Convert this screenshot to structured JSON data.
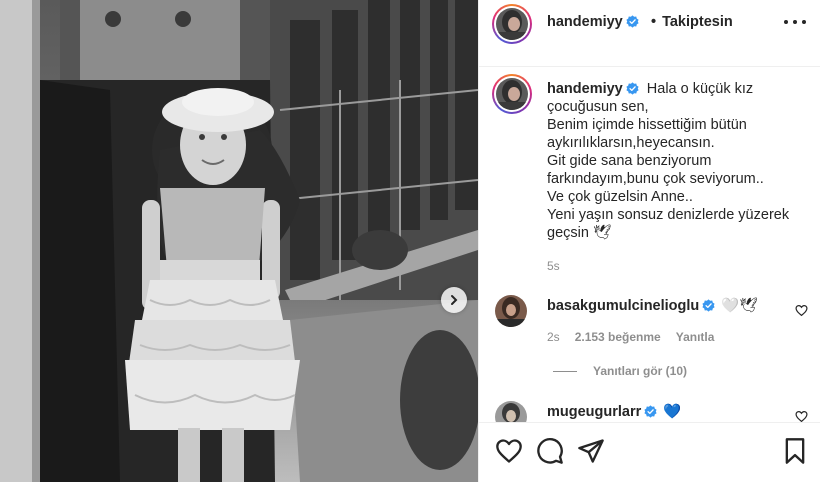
{
  "post": {
    "author": "handemiyy",
    "header_follow": "Takiptesin",
    "header_bullet": "•",
    "caption_lines": [
      "Hala o küçük kız",
      "çocuğusun sen,",
      "Benim içimde hissettiğim bütün",
      "aykırılıklarsın,heyecansın.",
      "Git gide sana benziyorum",
      "farkındayım,bunu çok seviyorum..",
      "Ve çok güzelsin Anne..",
      "Yeni yaşın sonsuz denizlerde yüzerek",
      "geçsin 🕊"
    ],
    "caption_time": "5s"
  },
  "comments": [
    {
      "username": "basakgumulcinelioglu",
      "text": "🤍🕊",
      "time": "2s",
      "likes": "2.153 beğenme",
      "reply_label": "Yanıtla",
      "view_replies": "Yanıtları gör (10)"
    },
    {
      "username": "mugeugurlarr",
      "text": "💙"
    }
  ],
  "icons": {
    "verified": "verified-badge-icon",
    "more": "more-options-icon",
    "next": "chevron-right-icon",
    "like": "heart-icon",
    "comment": "comment-icon",
    "share": "paper-plane-icon",
    "save": "bookmark-icon"
  },
  "colors": {
    "verified": "#3897f0",
    "text": "#262626",
    "muted": "#8e8e8e"
  }
}
